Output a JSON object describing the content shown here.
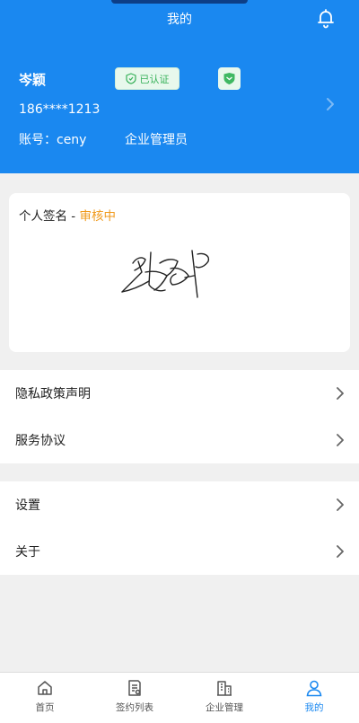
{
  "header": {
    "title": "我的",
    "user_name": "岑颖",
    "verified_label": "已认证",
    "phone": "186****1213",
    "account": "账号：ceny",
    "role": "企业管理员"
  },
  "signature": {
    "label": "个人签名 - ",
    "status": "审核中"
  },
  "menu_group_1": [
    {
      "label": "隐私政策声明"
    },
    {
      "label": "服务协议"
    }
  ],
  "menu_group_2": [
    {
      "label": "设置"
    },
    {
      "label": "关于"
    }
  ],
  "tabbar": {
    "tabs": [
      {
        "label": "首页",
        "icon": "home-icon"
      },
      {
        "label": "签约列表",
        "icon": "contract-list-icon"
      },
      {
        "label": "企业管理",
        "icon": "building-icon"
      },
      {
        "label": "我的",
        "icon": "user-icon"
      }
    ],
    "active_index": 3
  },
  "colors": {
    "primary": "#1a88f0",
    "status_pending": "#f09a1c",
    "verified_green": "#38b15a"
  }
}
